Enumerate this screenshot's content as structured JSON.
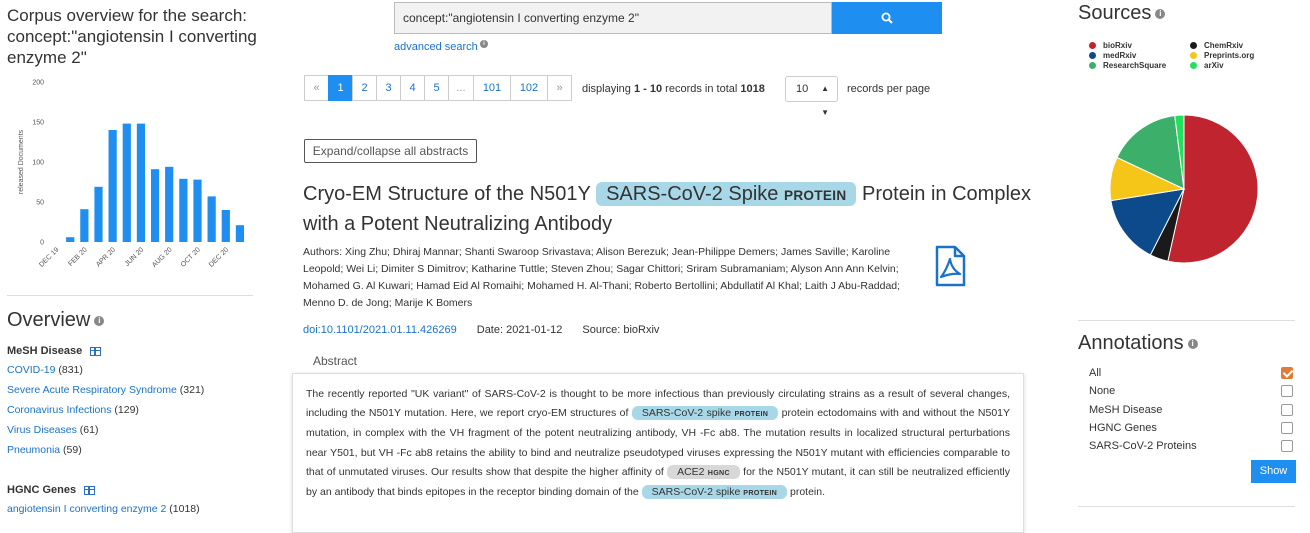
{
  "corpus": {
    "title": "Corpus overview for the search: concept:\"angiotensin I converting enzyme 2\""
  },
  "chart_data": {
    "type": "bar",
    "ylabel": "released Documents",
    "ylim": [
      0,
      200
    ],
    "yticks": [
      0,
      50,
      100,
      150,
      200
    ],
    "categories": [
      "DEC 19",
      "JAN 20",
      "FEB 20",
      "MAR 20",
      "APR 20",
      "MAY 20",
      "JUN 20",
      "JUL 20",
      "AUG 20",
      "SEP 20",
      "OCT 20",
      "NOV 20",
      "DEC 20",
      "JAN 21"
    ],
    "xticklabels": [
      "DEC 19",
      "FEB 20",
      "APR 20",
      "JUN 20",
      "AUG 20",
      "OCT 20",
      "DEC 20"
    ],
    "values": [
      0,
      6,
      41,
      69,
      140,
      148,
      148,
      91,
      94,
      79,
      78,
      57,
      40,
      21
    ],
    "color": "#1e8ef0"
  },
  "overview": {
    "title": "Overview",
    "mesh": {
      "heading": "MeSH Disease",
      "items": [
        {
          "label": "COVID-19",
          "count": "(831)"
        },
        {
          "label": "Severe Acute Respiratory Syndrome",
          "count": "(321)"
        },
        {
          "label": "Coronavirus Infections",
          "count": "(129)"
        },
        {
          "label": "Virus Diseases",
          "count": "(61)"
        },
        {
          "label": "Pneumonia",
          "count": "(59)"
        }
      ]
    },
    "hgnc": {
      "heading": "HGNC Genes",
      "items": [
        {
          "label": "angiotensin I converting enzyme 2",
          "count": "(1018)"
        }
      ]
    }
  },
  "search": {
    "value": "concept:\"angiotensin I converting enzyme 2\"",
    "advanced_label": "advanced search"
  },
  "pagination": {
    "pages": [
      "«",
      "1",
      "2",
      "3",
      "4",
      "5",
      "...",
      "101",
      "102",
      "»"
    ],
    "active": "1",
    "displaying_prefix": "displaying ",
    "range": "1 - 10",
    "records_in_total": " records in total ",
    "total": "1018",
    "per_page_value": "10",
    "per_page_label": "records per page"
  },
  "expand_label": "Expand/collapse all abstracts",
  "article": {
    "title_before": "Cryo-EM Structure of the N501Y",
    "title_hl_text": "SARS-CoV-2 Spike",
    "title_hl_tag": "PROTEIN",
    "title_after": "Protein in Complex with a Potent Neutralizing Antibody",
    "authors": "Authors: Xing Zhu; Dhiraj Mannar; Shanti Swaroop Srivastava; Alison Berezuk; Jean-Philippe Demers; James Saville; Karoline Leopold; Wei Li; Dimiter S Dimitrov; Katharine Tuttle; Steven Zhou; Sagar Chittori; Sriram Subramaniam; Alyson Ann Ann Kelvin; Mohamed G. Al Kuwari; Hamad Eid Al Romaihi; Mohamed H. Al-Thani; Roberto Bertollini; Abdullatif Al Khal; Laith J Abu-Raddad; Menno D. de Jong; Marije K Bomers",
    "doi": "doi:10.1101/2021.01.11.426269",
    "date": "Date: 2021-01-12",
    "source": "Source: bioRxiv",
    "abstract_tab": "Abstract",
    "abstract": {
      "p1": "The recently reported \"UK variant\" of SARS-CoV-2 is thought to be more infectious than previously circulating strains as a result of several changes, including the N501Y mutation. Here, we report cryo-EM structures of",
      "hl1_text": "SARS-CoV-2 spike",
      "hl1_tag": "PROTEIN",
      "p2": "protein ectodomains with and without the N501Y mutation, in complex with the VH fragment of the potent neutralizing antibody, VH -Fc ab8. The mutation results in localized structural perturbations near Y501, but VH -Fc ab8 retains the ability to bind and neutralize pseudotyped viruses expressing the N501Y mutant with efficiencies comparable to that of unmutated viruses. Our results show that despite the higher affinity of",
      "hl2_text": "ACE2",
      "hl2_tag": "HGNC",
      "p3": "for the N501Y mutant, it can still be neutralized efficiently by an antibody that binds epitopes in the receptor binding domain of the",
      "hl3_text": "SARS-CoV-2 spike",
      "hl3_tag": "PROTEIN",
      "p4": "protein."
    }
  },
  "sources": {
    "title": "Sources",
    "legend": [
      {
        "label": "bioRxiv",
        "color": "#c0242f"
      },
      {
        "label": "medRxiv",
        "color": "#0d4a8c"
      },
      {
        "label": "ResearchSquare",
        "color": "#3cb06b"
      },
      {
        "label": "ChemRxiv",
        "color": "#1a1a1a"
      },
      {
        "label": "Preprints.org",
        "color": "#f5c518"
      },
      {
        "label": "arXiv",
        "color": "#22e05c"
      }
    ],
    "pie": [
      {
        "label": "bioRxiv",
        "fraction": 0.535,
        "color": "#c0242f"
      },
      {
        "label": "ChemRxiv",
        "fraction": 0.04,
        "color": "#1a1a1a"
      },
      {
        "label": "medRxiv",
        "fraction": 0.15,
        "color": "#0d4a8c"
      },
      {
        "label": "Preprints.org",
        "fraction": 0.095,
        "color": "#f5c518"
      },
      {
        "label": "ResearchSquare",
        "fraction": 0.16,
        "color": "#3cb06b"
      },
      {
        "label": "arXiv",
        "fraction": 0.02,
        "color": "#22e05c"
      }
    ]
  },
  "annotations": {
    "title": "Annotations",
    "items": [
      {
        "label": "All",
        "checked": true
      },
      {
        "label": "None",
        "checked": false
      },
      {
        "label": "MeSH Disease",
        "checked": false
      },
      {
        "label": "HGNC Genes",
        "checked": false
      },
      {
        "label": "SARS-CoV-2 Proteins",
        "checked": false
      }
    ],
    "show_label": "Show"
  }
}
